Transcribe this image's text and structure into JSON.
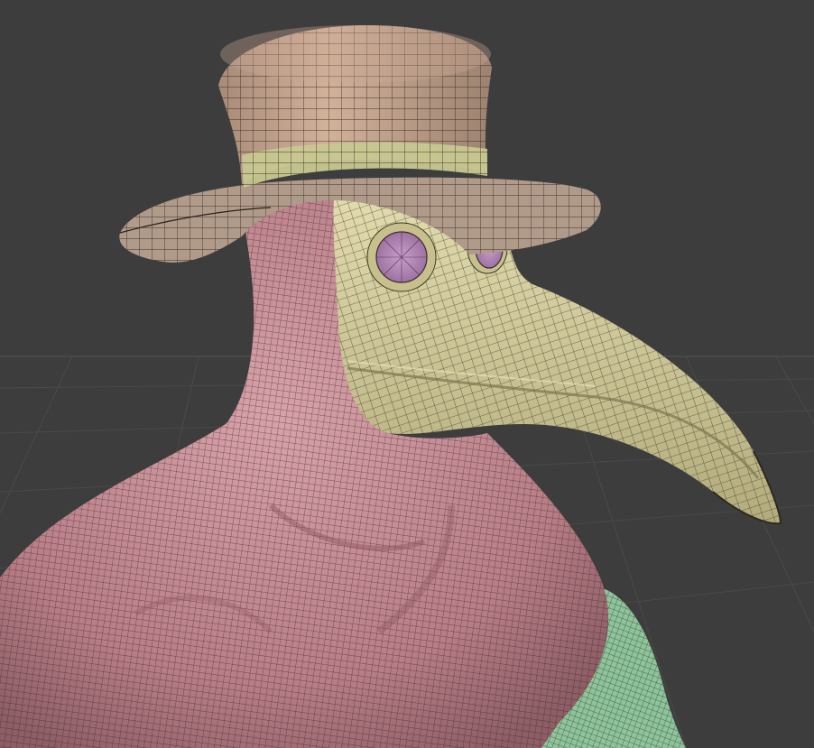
{
  "viewport": {
    "shading_mode": "solid-wireframe",
    "background_color": "#3d3d3d",
    "grid_floor": true
  },
  "model": {
    "name": "plague-doctor-bust",
    "parts": [
      {
        "name": "top-hat",
        "color": "#c0a08a"
      },
      {
        "name": "hat-band",
        "color": "#c8c890"
      },
      {
        "name": "hat-brim",
        "color": "#b09a8a"
      },
      {
        "name": "hood",
        "color": "#c48c94"
      },
      {
        "name": "beak-mask",
        "color": "#d2c99a"
      },
      {
        "name": "eye-lens",
        "color": "#bf8ec0"
      },
      {
        "name": "sleeve",
        "color": "#8fc49a"
      }
    ]
  }
}
